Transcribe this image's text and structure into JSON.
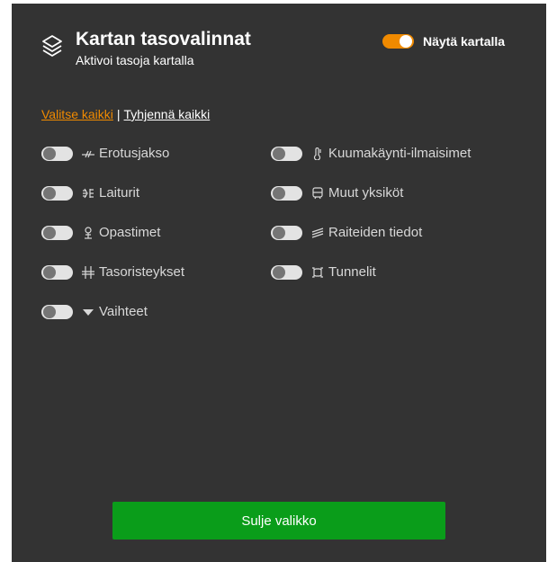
{
  "header": {
    "icon": "layers-icon",
    "title": "Kartan tasovalinnat",
    "subtitle": "Aktivoi tasoja kartalla",
    "show_map": {
      "label": "Näytä kartalla",
      "on": true
    }
  },
  "actions": {
    "select_all": "Valitse kaikki",
    "separator": "|",
    "clear_all": "Tyhjennä kaikki"
  },
  "layers": {
    "left": [
      {
        "label": "Erotusjakso",
        "icon": "section-break-icon",
        "on": false
      },
      {
        "label": "Laiturit",
        "icon": "platform-icon",
        "on": false
      },
      {
        "label": "Opastimet",
        "icon": "signal-icon",
        "on": false
      },
      {
        "label": "Tasoristeykset",
        "icon": "level-crossing-icon",
        "on": false
      },
      {
        "label": "Vaihteet",
        "icon": "switch-triangle-icon",
        "on": false
      }
    ],
    "right": [
      {
        "label": "Kuumakäynti-ilmaisimet",
        "icon": "thermometer-icon",
        "on": false
      },
      {
        "label": "Muut yksiköt",
        "icon": "train-unit-icon",
        "on": false
      },
      {
        "label": "Raiteiden tiedot",
        "icon": "track-info-icon",
        "on": false
      },
      {
        "label": "Tunnelit",
        "icon": "tunnel-icon",
        "on": false
      }
    ]
  },
  "footer": {
    "close_label": "Sulje valikko"
  },
  "colors": {
    "panel": "#333333",
    "accent": "#f08a00",
    "button": "#0a9d1a"
  }
}
